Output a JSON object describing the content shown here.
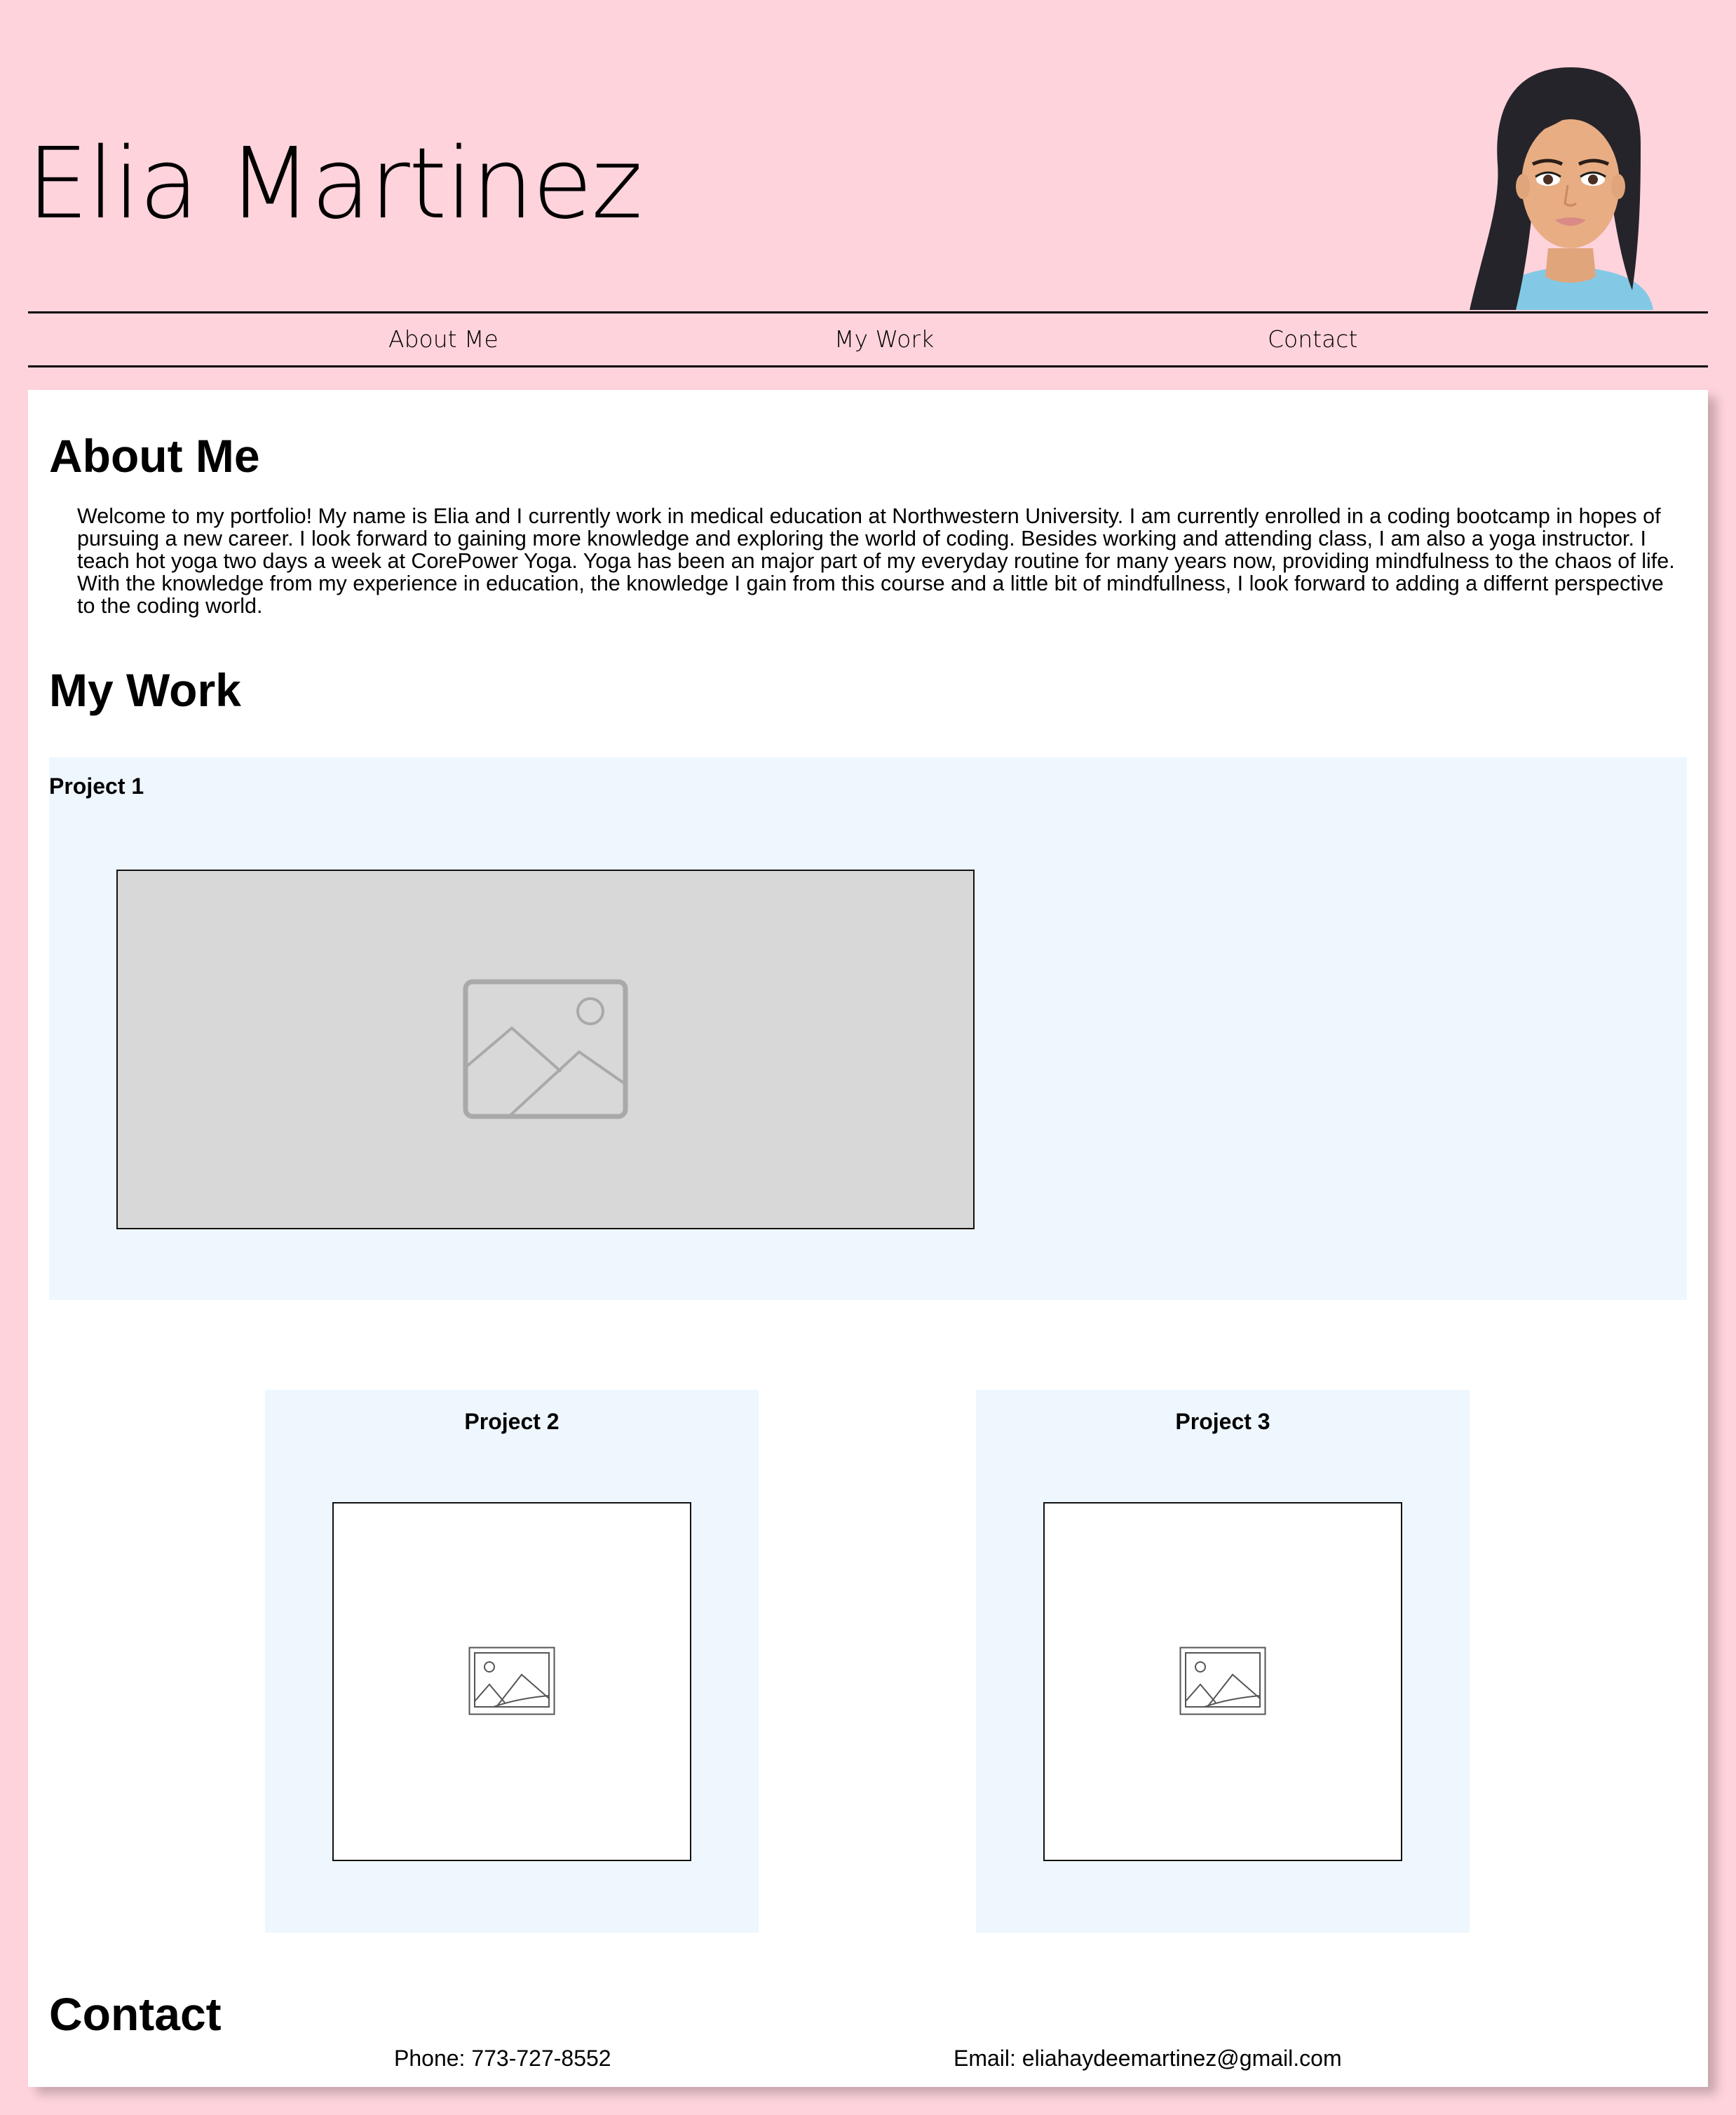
{
  "header": {
    "title": "Elia Martinez",
    "avatar_icon": "avatar-cartoon-woman"
  },
  "nav": {
    "items": [
      {
        "label": "About Me"
      },
      {
        "label": "My Work"
      },
      {
        "label": "Contact"
      }
    ]
  },
  "about": {
    "heading": "About Me",
    "text": "Welcome to my portfolio! My name is Elia and I currently work in medical education at Northwestern University. I am currently enrolled in a coding bootcamp in hopes of pursuing a new career. I look forward to gaining more knowledge and exploring the world of coding. Besides working and attending class, I am also a yoga instructor. I teach hot yoga two days a week at CorePower Yoga. Yoga has been an major part of my everyday routine for many years now, providing mindfulness to the chaos of life. With the knowledge from my experience in education, the knowledge I gain from this course and a little bit of mindfullness, I look forward to adding a differnt perspective to the coding world."
  },
  "work": {
    "heading": "My Work",
    "projects": [
      {
        "label": "Project 1",
        "image_icon": "image-placeholder-icon"
      },
      {
        "label": "Project 2",
        "image_icon": "image-placeholder-icon"
      },
      {
        "label": "Project 3",
        "image_icon": "image-placeholder-icon"
      }
    ]
  },
  "contact": {
    "heading": "Contact",
    "phone": "Phone: 773-727-8552",
    "email": "Email: eliahaydeemartinez@gmail.com"
  },
  "colors": {
    "page_background": "#ffd3dc",
    "card_background": "#ffffff",
    "project_background": "#eef6fe",
    "placeholder_gray": "#d8d8d8"
  }
}
